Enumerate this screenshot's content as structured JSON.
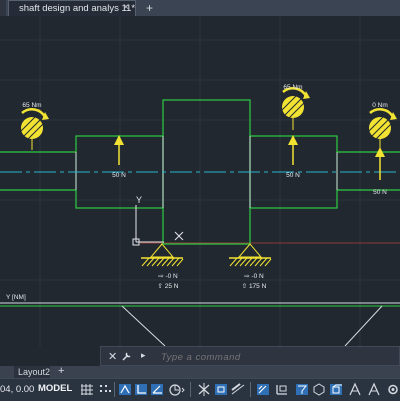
{
  "window": {
    "file_tab_title": "shaft design and analys 11*",
    "file_tab_close": "×",
    "new_tab": "+"
  },
  "drawing": {
    "moments": [
      {
        "label": "65 Nm"
      },
      {
        "label": "65 Nm"
      },
      {
        "label": "0 Nm"
      }
    ],
    "forces": [
      {
        "label": "50 N"
      },
      {
        "label": "50 N"
      },
      {
        "label": "50 N"
      }
    ],
    "supports": [
      {
        "rx": "⇨ -0 N",
        "ry": "⇧ 25 N"
      },
      {
        "rx": "⇨ -0 N",
        "ry": "⇧ 175 N"
      }
    ],
    "ucs_y_label": "Y",
    "graph_label": "Y [NM]",
    "colors": {
      "shaft": "#2ecc40",
      "centerline": "#29b6d1",
      "load": "#f2e232",
      "background": "#212830",
      "axis_red": "#c0392b"
    }
  },
  "command_line": {
    "close": "✕",
    "prompt_icon": "▸",
    "placeholder": "Type a command"
  },
  "layout_tabs": {
    "active": "Layout2",
    "add": "+"
  },
  "status_bar": {
    "coordinates": "04, 0.00",
    "model": "MODEL"
  }
}
